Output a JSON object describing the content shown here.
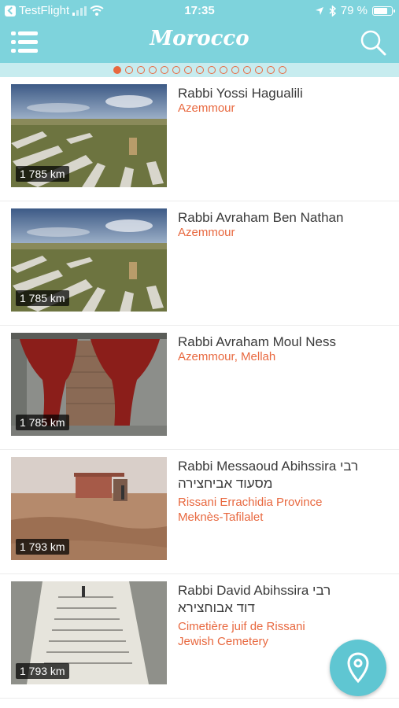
{
  "status_bar": {
    "carrier": "TestFlight",
    "time": "17:35",
    "battery": "79 %",
    "battery_level": 0.79
  },
  "header": {
    "title": "Morocco",
    "menu_icon": "hamburger-menu-icon",
    "search_icon": "search-icon"
  },
  "pager": {
    "total": 15,
    "active": 0
  },
  "items": [
    {
      "name": "Rabbi Yossi Hagualili",
      "name_he": "",
      "location_1": "Azemmour",
      "location_2": "",
      "distance": "1 785 km",
      "photo": "cemetery"
    },
    {
      "name": "Rabbi Avraham Ben Nathan",
      "name_he": "",
      "location_1": "Azemmour",
      "location_2": "",
      "distance": "1 785 km",
      "photo": "cemetery"
    },
    {
      "name": "Rabbi Avraham Moul Ness",
      "name_he": "",
      "location_1": "Azemmour, Mellah",
      "location_2": "",
      "distance": "1 785 km",
      "photo": "curtain"
    },
    {
      "name": "Rabbi Messaoud Abihssira רבי",
      "name_he": "מסעוד אביחצירה",
      "location_1": "Rissani Errachidia Province",
      "location_2": "Meknès-Tafilalet",
      "distance": "1 793 km",
      "photo": "desert"
    },
    {
      "name": "Rabbi David Abihssira רבי",
      "name_he": "דוד אבוחצירא",
      "location_1": "Cimetière juif de Rissani",
      "location_2": "Jewish Cemetery",
      "distance": "1 793 km",
      "photo": "tomb"
    }
  ],
  "fab": {
    "icon": "map-pin-icon"
  },
  "colors": {
    "primary": "#7ed3dc",
    "accent": "#e8683f",
    "fab": "#5fc6d2"
  }
}
